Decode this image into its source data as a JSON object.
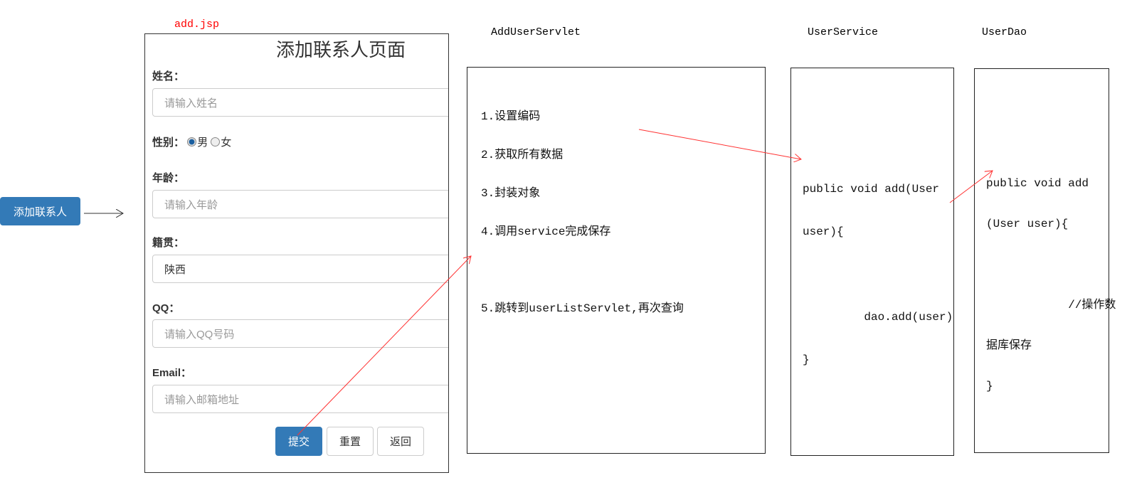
{
  "entry_button": "添加联系人",
  "jsp_label": "add.jsp",
  "form": {
    "title": "添加联系人页面",
    "name_label": "姓名：",
    "name_placeholder": "请输入姓名",
    "gender_label": "性别：",
    "gender_male": "男",
    "gender_female": "女",
    "age_label": "年龄：",
    "age_placeholder": "请输入年龄",
    "origin_label": "籍贯：",
    "origin_value": "陕西",
    "qq_label": "QQ：",
    "qq_placeholder": "请输入QQ号码",
    "email_label": "Email：",
    "email_placeholder": "请输入邮箱地址",
    "submit": "提交",
    "reset": "重置",
    "back": "返回"
  },
  "servlet": {
    "title": "AddUserServlet",
    "steps": [
      "1.设置编码",
      "2.获取所有数据",
      "3.封装对象",
      "4.调用service完成保存",
      "5.跳转到userListServlet,再次查询"
    ]
  },
  "service": {
    "title": "UserService",
    "code": [
      "public void add(User",
      "user){",
      "",
      "         dao.add(user)",
      "}"
    ]
  },
  "dao": {
    "title": "UserDao",
    "code": [
      "public void add",
      "(User user){",
      "",
      "            //操作数",
      "据库保存",
      "}"
    ]
  },
  "colors": {
    "arrow": "#ff3333",
    "primary": "#337ab7"
  }
}
